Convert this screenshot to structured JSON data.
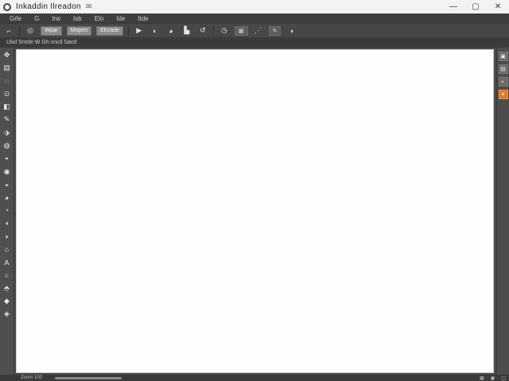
{
  "window": {
    "title": "Inkaddin Ilreadon",
    "pin_icon": "chat-bubble-icon",
    "controls": [
      "—",
      "▢",
      "✕"
    ]
  },
  "menubar": {
    "items": [
      "Grle",
      "G",
      "Irw",
      "Isb",
      "Elo",
      "Ide",
      "Itde"
    ]
  },
  "optionsbar": {
    "fields": [
      "Wpar",
      "Mopen",
      "Elcrade"
    ],
    "icons": [
      "crop-icon",
      "circle-icon",
      "camera-icon",
      "camera-alt-icon",
      "brush-icon",
      "rotate-icon",
      "clock-icon",
      "layers-icon",
      "grid-icon",
      "pen-icon"
    ]
  },
  "tabrow": {
    "label": "Ulwl  Snrde W  Gh vncd  Sacd"
  },
  "toolbox": {
    "icons": [
      "move-icon",
      "selection-icon",
      "lasso-icon",
      "crop-icon",
      "eyedropper-icon",
      "brush-icon",
      "eraser-icon",
      "stamp-icon",
      "gradient-icon",
      "blur-icon",
      "dodge-icon",
      "pen-icon",
      "shape-icon",
      "hand-icon",
      "zoom-icon",
      "paint-bucket-icon",
      "text-icon",
      "circle-icon",
      "fill-icon",
      "foreground-icon",
      "background-icon"
    ]
  },
  "rightpanel": {
    "buttons": [
      "layers-icon",
      "history-icon",
      "adjust-icon",
      "color-swatch-icon"
    ],
    "accent": "#e07b28"
  },
  "statusbar": {
    "zoom": "Zoom 100",
    "icons": [
      "grid-status-icon",
      "lock-status-icon",
      "fit-status-icon"
    ]
  }
}
